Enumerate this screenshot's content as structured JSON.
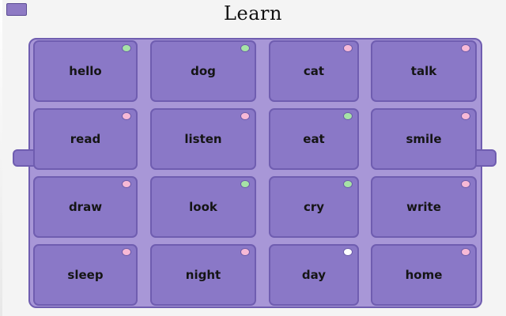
{
  "header": {
    "title": "Learn"
  },
  "colors": {
    "pink": "#f7b9d6",
    "green": "#a6e3a6",
    "white": "#ffffff"
  },
  "cards": [
    {
      "word": "hello",
      "dot": "green"
    },
    {
      "word": "dog",
      "dot": "green"
    },
    {
      "word": "cat",
      "dot": "pink"
    },
    {
      "word": "talk",
      "dot": "pink"
    },
    {
      "word": "read",
      "dot": "pink"
    },
    {
      "word": "listen",
      "dot": "pink"
    },
    {
      "word": "eat",
      "dot": "green"
    },
    {
      "word": "smile",
      "dot": "pink"
    },
    {
      "word": "draw",
      "dot": "pink"
    },
    {
      "word": "look",
      "dot": "green"
    },
    {
      "word": "cry",
      "dot": "green"
    },
    {
      "word": "write",
      "dot": "pink"
    },
    {
      "word": "sleep",
      "dot": "pink"
    },
    {
      "word": "night",
      "dot": "pink"
    },
    {
      "word": "day",
      "dot": "white"
    },
    {
      "word": "home",
      "dot": "pink"
    }
  ]
}
